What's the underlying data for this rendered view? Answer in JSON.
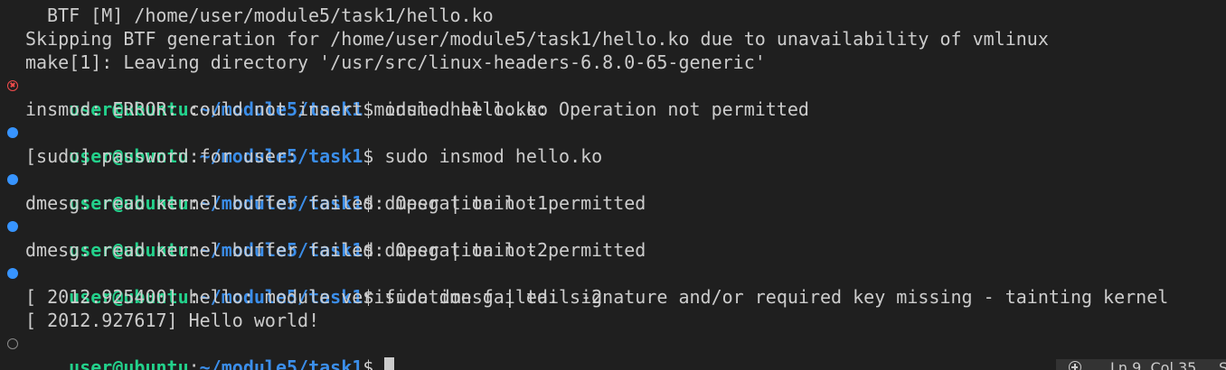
{
  "terminal": {
    "prompt": {
      "user": "user@ubuntu",
      "colon": ":",
      "path": "~/module5/task1",
      "dollar": "$"
    },
    "lines": [
      {
        "kind": "output",
        "indent": true,
        "text": "BTF [M] /home/user/module5/task1/hello.ko"
      },
      {
        "kind": "output",
        "text": "Skipping BTF generation for /home/user/module5/task1/hello.ko due to unavailability of vmlinux"
      },
      {
        "kind": "output",
        "text": "make[1]: Leaving directory '/usr/src/linux-headers-6.8.0-65-generic'"
      },
      {
        "kind": "command",
        "status": "error",
        "command": " insmod hello.ko"
      },
      {
        "kind": "output",
        "text": "insmod: ERROR: could not insert module hello.ko: Operation not permitted"
      },
      {
        "kind": "command",
        "status": "success",
        "command": " sudo insmod hello.ko"
      },
      {
        "kind": "output",
        "text": "[sudo] password for user:"
      },
      {
        "kind": "command",
        "status": "success",
        "command": " dmesg | tail -1"
      },
      {
        "kind": "output",
        "text": "dmesg: read kernel buffer failed: Operation not permitted"
      },
      {
        "kind": "command",
        "status": "success",
        "command": " dmesg | tail -2"
      },
      {
        "kind": "output",
        "text": "dmesg: read kernel buffer failed: Operation not permitted"
      },
      {
        "kind": "command",
        "status": "success",
        "command": " sudo dmesg | tail -2"
      },
      {
        "kind": "output",
        "text": "[ 2012.925400] hello: module verification failed: signature and/or required key missing - tainting kernel"
      },
      {
        "kind": "output",
        "text": "[ 2012.927617] Hello world!"
      },
      {
        "kind": "command",
        "status": "default",
        "command": " "
      }
    ]
  },
  "status_bar": {
    "position": "Ln 9, Col 35",
    "extra": "S",
    "icon": "zoom-in-icon"
  },
  "colors": {
    "background": "#1f1f1f",
    "user": "#23d18b",
    "path": "#3b8eea",
    "success_dot": "#3794ff",
    "error_mark": "#f14c4c"
  }
}
